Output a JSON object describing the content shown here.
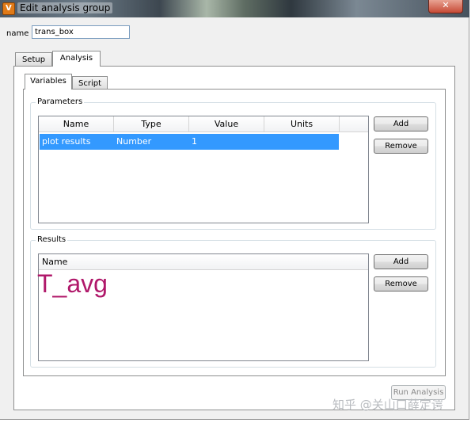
{
  "window": {
    "title": "Edit analysis group",
    "app_icon_letter": "V",
    "close_glyph": "✕"
  },
  "name_field": {
    "label": "name",
    "value": "trans_box"
  },
  "outer_tabs": [
    {
      "label": "Setup",
      "active": false
    },
    {
      "label": "Analysis",
      "active": true
    }
  ],
  "inner_tabs": [
    {
      "label": "Variables",
      "active": true
    },
    {
      "label": "Script",
      "active": false
    }
  ],
  "parameters": {
    "group_label": "Parameters",
    "columns": [
      "Name",
      "Type",
      "Value",
      "Units"
    ],
    "rows": [
      {
        "name": "plot results",
        "type": "Number",
        "value": "1",
        "units": ""
      }
    ],
    "add_label": "Add",
    "remove_label": "Remove"
  },
  "results": {
    "group_label": "Results",
    "column": "Name",
    "annotation": "T_avg",
    "add_label": "Add",
    "remove_label": "Remove"
  },
  "run_analysis_label": "Run Analysis",
  "watermark": "知乎 @关山口薛定谔",
  "colors": {
    "selection": "#3399ff",
    "annotation": "#b0186a"
  }
}
